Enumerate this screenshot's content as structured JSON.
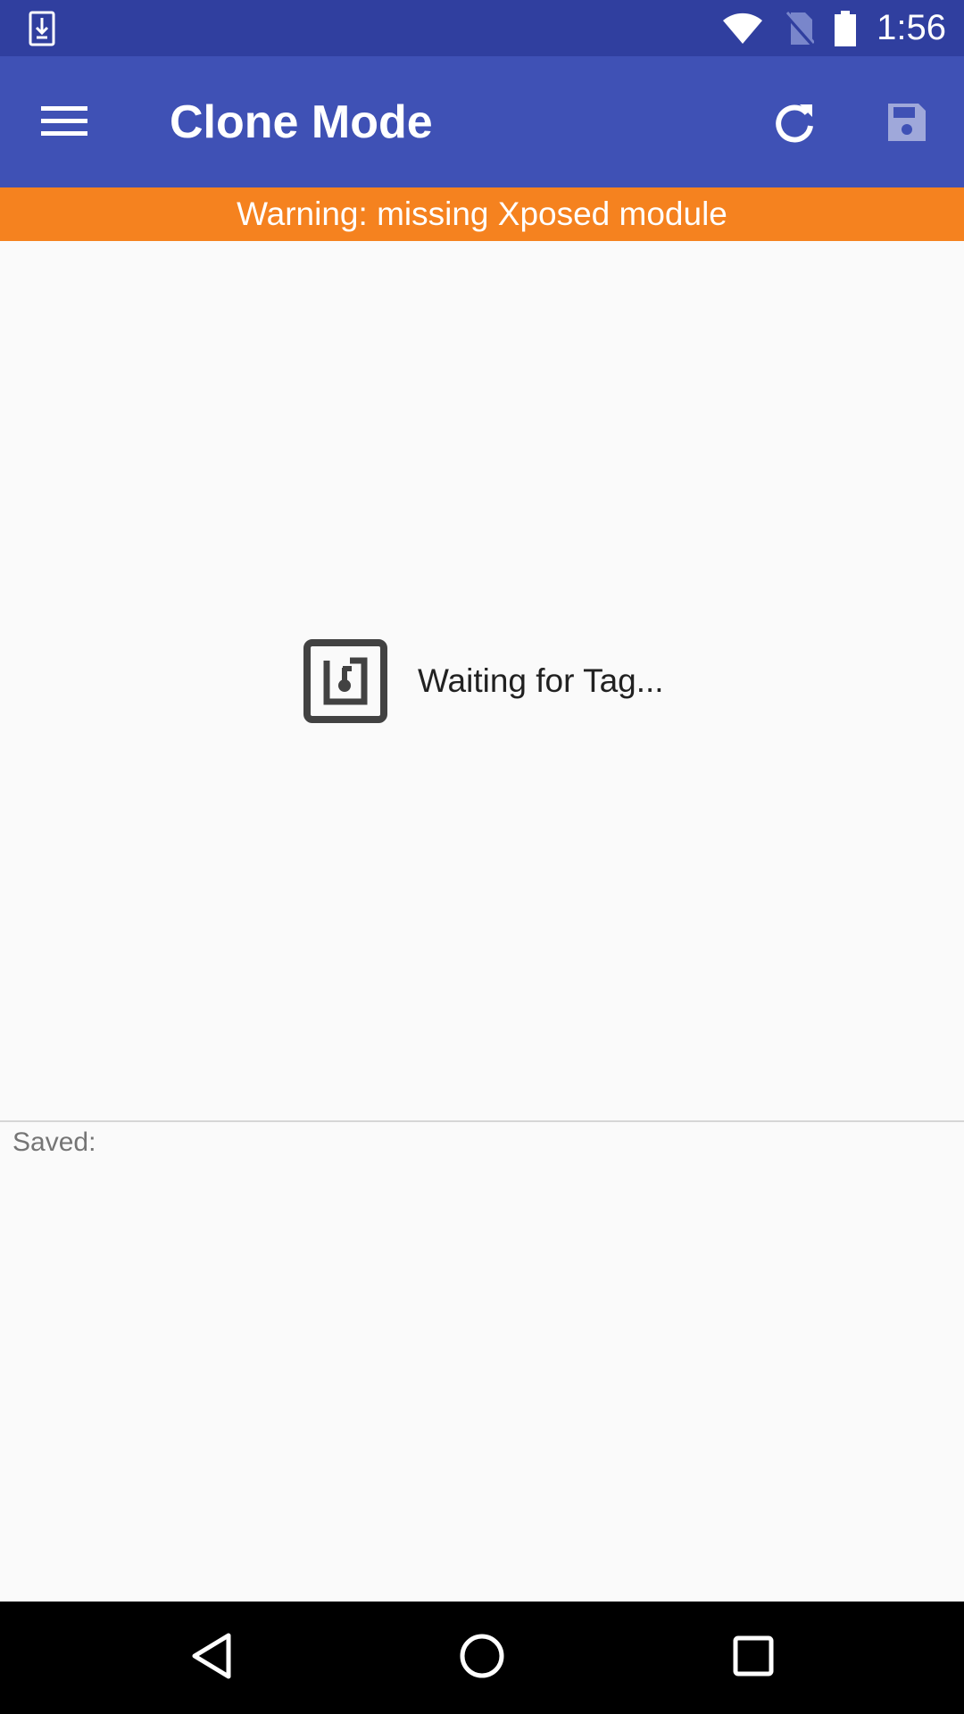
{
  "status_bar": {
    "time": "1:56",
    "icons": [
      "download-notification-icon",
      "wifi-icon",
      "no-sim-icon",
      "battery-icon"
    ]
  },
  "app_bar": {
    "title": "Clone Mode",
    "icons": [
      "menu-icon",
      "refresh-icon",
      "save-icon"
    ]
  },
  "warning": {
    "text": "Warning: missing Xposed module",
    "color": "#f5821f"
  },
  "main": {
    "status_text": "Waiting for Tag...",
    "status_icon": "nfc-icon",
    "saved_label": "Saved:"
  },
  "nav_bar": {
    "icons": [
      "back-icon",
      "home-icon",
      "recents-icon"
    ]
  },
  "colors": {
    "primary": "#3f51b5",
    "primary_dark": "#303f9f",
    "warning": "#f5821f",
    "background": "#fafafa"
  }
}
